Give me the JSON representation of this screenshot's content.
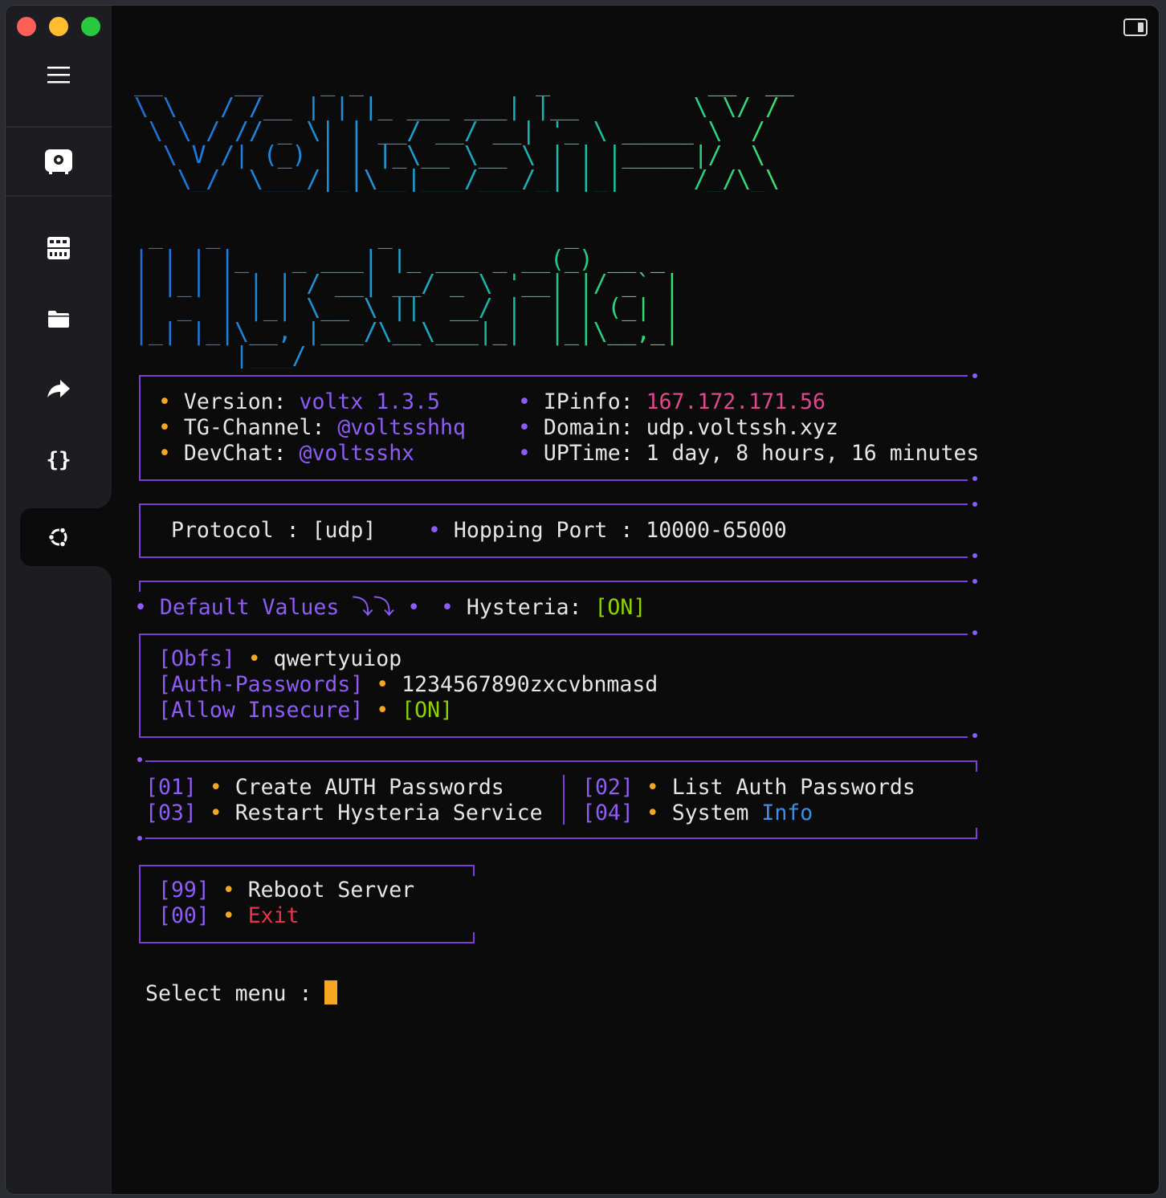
{
  "window": {
    "sidebar_icons": [
      "menu-icon",
      "server-gear-icon",
      "grid-storage-icon",
      "folder-icon",
      "forward-icon",
      "code-braces-icon",
      "ubuntu-icon"
    ]
  },
  "banner": {
    "line1": [
      "__     __    _ _            _           __  __",
      "\\ \\   / /__ | | |_ ___ ___| |__        \\ \\/ /",
      " \\ \\ / // _ \\| | __/ __/ __| '_ \\ _____ \\  / ",
      "  \\ V /| (_) | | |_\\__ \\__ \\ | | |_____|/  \\ ",
      "   \\_/  \\___/|_|\\__|___/___/_| |_|     /_/\\_\\"
    ],
    "line2": [
      " _   _           _            _",
      "| | | |_   _ ___| |_ ___ _ __(_) __ _",
      "| |_| | | | / __| __/ _ \\ '__| |/ _` |",
      "|  _  | |_| \\__ \\ ||  __/ |  | | (_| |",
      "|_| |_|\\__, |___/\\__\\___|_|  |_|\\__,_|",
      "       |___/"
    ]
  },
  "info": {
    "version_label": "Version: ",
    "version_value": "voltx 1.3.5",
    "tg_label": "TG-Channel: ",
    "tg_value": "@voltsshhq",
    "devchat_label": "DevChat: ",
    "devchat_value": "@voltsshx",
    "ipinfo_label": "IPinfo: ",
    "ipinfo_value": "167.172.171.56",
    "domain_label": "Domain: ",
    "domain_value": "udp.voltssh.xyz",
    "uptime_label": "UPTime: ",
    "uptime_value": "1 day, 8 hours, 16 minutes"
  },
  "protocol": {
    "protocol_text": "Protocol : [udp]",
    "hopping_text": "Hopping Port : 10000-65000"
  },
  "defaults": {
    "title": "Default Values",
    "arrow": "⤵⤵",
    "hysteria_label": "Hysteria: ",
    "hysteria_value": "[ON]",
    "obfs_key": "[Obfs]",
    "obfs_value": "qwertyuiop",
    "auth_key": "[Auth-Passwords]",
    "auth_value": "1234567890zxcvbnmasd",
    "insecure_key": "[Allow Insecure]",
    "insecure_value": "[ON]"
  },
  "menu": {
    "items": [
      {
        "num": "[01]",
        "label": "Create AUTH Passwords"
      },
      {
        "num": "[02]",
        "label": "List Auth Passwords"
      },
      {
        "num": "[03]",
        "label": "Restart Hysteria Service"
      },
      {
        "num": "[04]",
        "label_a": "System ",
        "label_b": "Info"
      }
    ],
    "reboot_num": "[99]",
    "reboot_label": "Reboot Server",
    "exit_num": "[00]",
    "exit_label": "Exit"
  },
  "prompt": {
    "text": "Select menu : "
  }
}
